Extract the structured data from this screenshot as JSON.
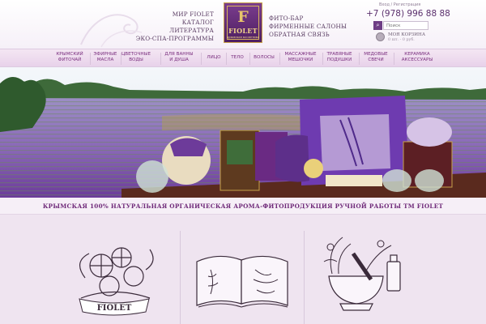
{
  "header": {
    "nav_left": [
      "МИР FIOLET",
      "КАТАЛОГ",
      "ЛИТЕРАТУРА",
      "ЭКО-СПА-ПРОГРАММЫ"
    ],
    "nav_right": [
      "ФИТО-БАР",
      "ФИРМЕННЫЕ САЛОНЫ",
      "ОБРАТНАЯ СВЯЗЬ"
    ],
    "logo": {
      "letter": "F",
      "name": "FIOLET",
      "tagline": "крымская косметика"
    },
    "login": "Вход / Регистрация",
    "phone": "+7 (978) 996 88 88",
    "search": {
      "placeholder": "Поиск"
    },
    "cart": {
      "title": "МОЯ КОРЗИНА",
      "summary": "0 шт. - 0 руб."
    }
  },
  "main_nav": [
    [
      "КРЫМСКИЙ",
      "ФИТОЧАЙ"
    ],
    [
      "ЭФИРНЫЕ",
      "МАСЛА"
    ],
    [
      "ЦВЕТОЧНЫЕ",
      "ВОДЫ"
    ],
    [
      "ДЛЯ ВАННЫ",
      "И ДУША"
    ],
    [
      "ЛИЦО"
    ],
    [
      "ТЕЛО"
    ],
    [
      "ВОЛОСЫ"
    ],
    [
      "МАССАЖНЫЕ",
      "МЕШОЧКИ"
    ],
    [
      "ТРАВЯНЫЕ",
      "ПОДУШКИ"
    ],
    [
      "МЕДОВЫЕ",
      "СВЕЧИ"
    ],
    [
      "КЕРАМИКА",
      "АКСЕССУАРЫ"
    ]
  ],
  "tagline": "КРЫМСКАЯ 100% НАТУРАЛЬНАЯ ОРГАНИЧЕСКАЯ АРОМА-ФИТОПРОДУКЦИЯ РУЧНОЙ РАБОТЫ ТМ FIOLET",
  "cards": [
    {
      "icon": "flower-bouquet-icon",
      "banner": "FIOLET"
    },
    {
      "icon": "open-book-icon"
    },
    {
      "icon": "mortar-pestle-icon"
    }
  ],
  "colors": {
    "brand_purple": "#6f2a79",
    "nav_bg": "#ecdaed",
    "page_bg": "#efe4f0",
    "gold": "#d9b45c"
  }
}
